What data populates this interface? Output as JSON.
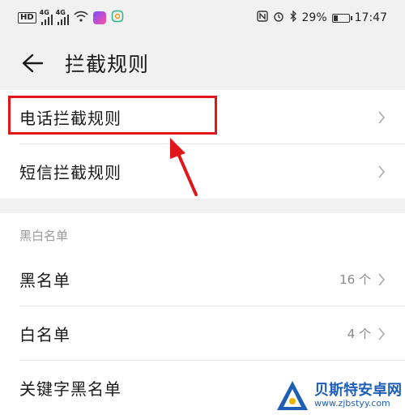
{
  "status_bar": {
    "left_badge": "HD",
    "signal_tag": "4G",
    "battery_text": "29%",
    "battery_level": 0.29,
    "time": "17:47"
  },
  "header": {
    "title": "拦截规则"
  },
  "rules": {
    "items": [
      {
        "label": "电话拦截规则"
      },
      {
        "label": "短信拦截规则"
      }
    ]
  },
  "lists": {
    "section_title": "黑白名单",
    "items": [
      {
        "label": "黑名单",
        "count": "16 个"
      },
      {
        "label": "白名单",
        "count": "4 个"
      },
      {
        "label": "关键字黑名单"
      }
    ]
  },
  "watermark": {
    "title": "贝斯特安卓网",
    "url": "www.zjbstyy.com"
  },
  "colors": {
    "highlight": "#e0161b",
    "watermark": "#1e5fb5"
  }
}
